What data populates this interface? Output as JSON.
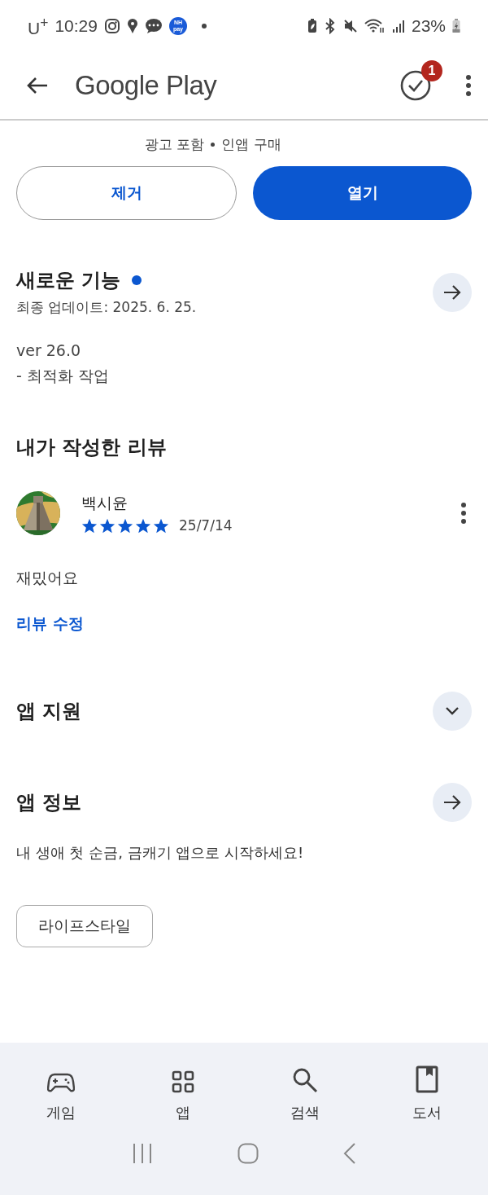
{
  "status_bar": {
    "carrier": "U$^{+}$",
    "time": "10:29",
    "pay_icon": [
      "NH",
      "pay"
    ],
    "battery": "23%"
  },
  "header": {
    "title": "Google Play",
    "badge": "1"
  },
  "app": {
    "meta": [
      "광고 포함",
      "인앱 구매"
    ],
    "buttons": [
      {
        "label": "제거",
        "kind": "outline"
      },
      {
        "label": "열기",
        "kind": "filled"
      }
    ]
  },
  "whats_new": {
    "title": "새로운 기능",
    "has_update": true,
    "subtitle": "최종 업데이트: 2025. 6. 25.",
    "lines": [
      "ver 26.0",
      "- 최적화 작업"
    ]
  },
  "my_review": {
    "title": "내가 작성한 리뷰",
    "reviewer": "백시윤",
    "stars": 5,
    "date": "25/7/14",
    "text": "재밌어요",
    "edit_link": "리뷰 수정"
  },
  "app_support": {
    "title": "앱 지원",
    "expanded": false
  },
  "app_info": {
    "title": "앱 정보",
    "description": "내 생애 첫 순금, 금캐기 앱으로 시작하세요!",
    "tags": [
      "라이프스타일"
    ]
  },
  "bottom_nav": [
    {
      "label": "게임",
      "kind": "games"
    },
    {
      "label": "앱",
      "kind": "apps"
    },
    {
      "label": "검색",
      "kind": "search"
    },
    {
      "label": "도서",
      "kind": "books"
    }
  ]
}
